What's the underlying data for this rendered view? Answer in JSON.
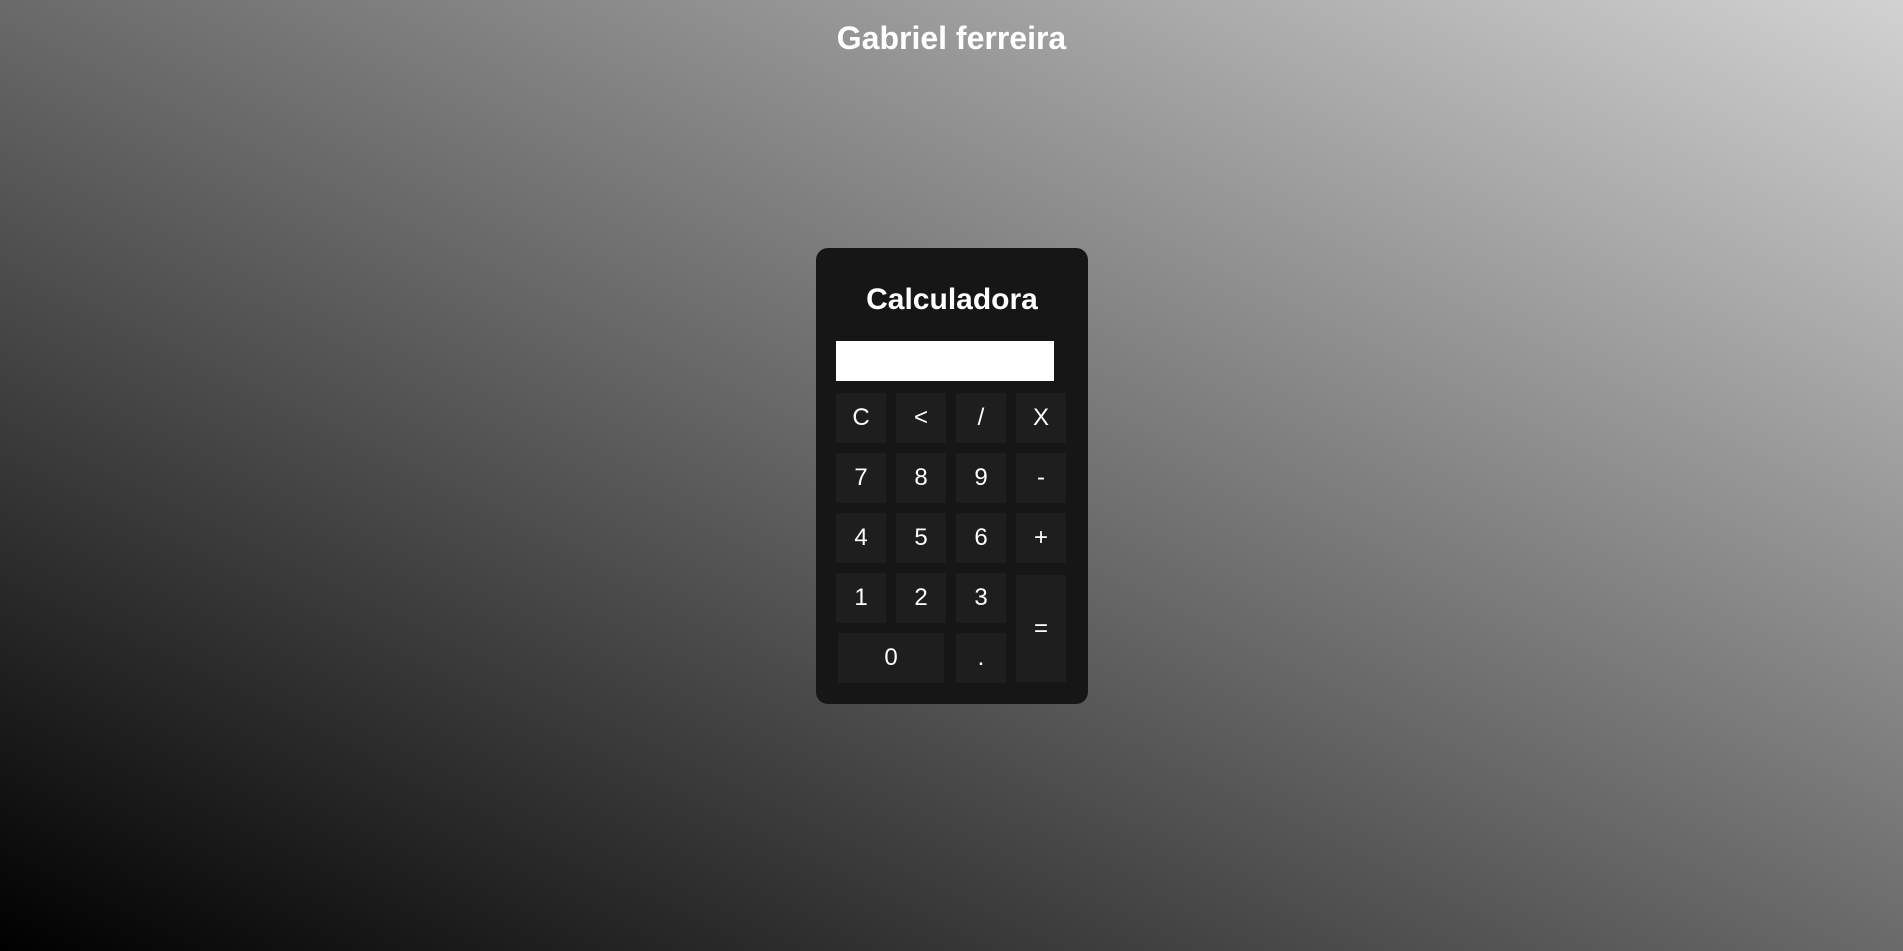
{
  "page": {
    "title": "Gabriel ferreira"
  },
  "calculator": {
    "title": "Calculadora",
    "display_value": "",
    "buttons": {
      "clear": "C",
      "backspace": "<",
      "divide": "/",
      "multiply": "X",
      "seven": "7",
      "eight": "8",
      "nine": "9",
      "minus": "-",
      "four": "4",
      "five": "5",
      "six": "6",
      "plus": "+",
      "one": "1",
      "two": "2",
      "three": "3",
      "equals": "=",
      "zero": "0",
      "decimal": "."
    }
  },
  "colors": {
    "panel_background": "#161616",
    "button_background": "#1e1e1e",
    "display_background": "#ffffff",
    "text": "#ffffff"
  }
}
